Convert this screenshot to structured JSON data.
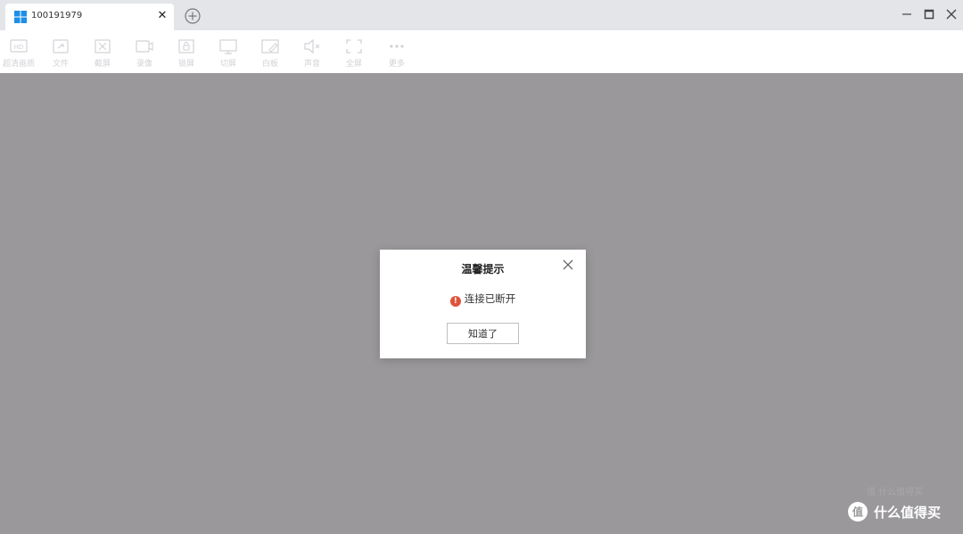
{
  "tab": {
    "title": "100191979",
    "close_label": "✕"
  },
  "toolbar": {
    "items": [
      {
        "name": "hd",
        "label": "超清画质"
      },
      {
        "name": "file",
        "label": "文件"
      },
      {
        "name": "screenshot",
        "label": "截屏"
      },
      {
        "name": "record",
        "label": "录像"
      },
      {
        "name": "lock",
        "label": "锁屏"
      },
      {
        "name": "switch-screen",
        "label": "切屏"
      },
      {
        "name": "whiteboard",
        "label": "白板"
      },
      {
        "name": "sound",
        "label": "声音"
      },
      {
        "name": "fullscreen",
        "label": "全屏"
      },
      {
        "name": "more",
        "label": "更多"
      }
    ]
  },
  "dialog": {
    "title": "温馨提示",
    "message": "连接已断开",
    "button": "知道了",
    "error_icon_glyph": "!"
  },
  "watermark": {
    "faint": "值 什么值得买",
    "logo_glyph": "值",
    "text": "什么值得买"
  },
  "colors": {
    "background": "#9a989b",
    "tabbar": "#e4e5e9",
    "error": "#e0533b",
    "windows_blue": "#1e8fe8"
  }
}
